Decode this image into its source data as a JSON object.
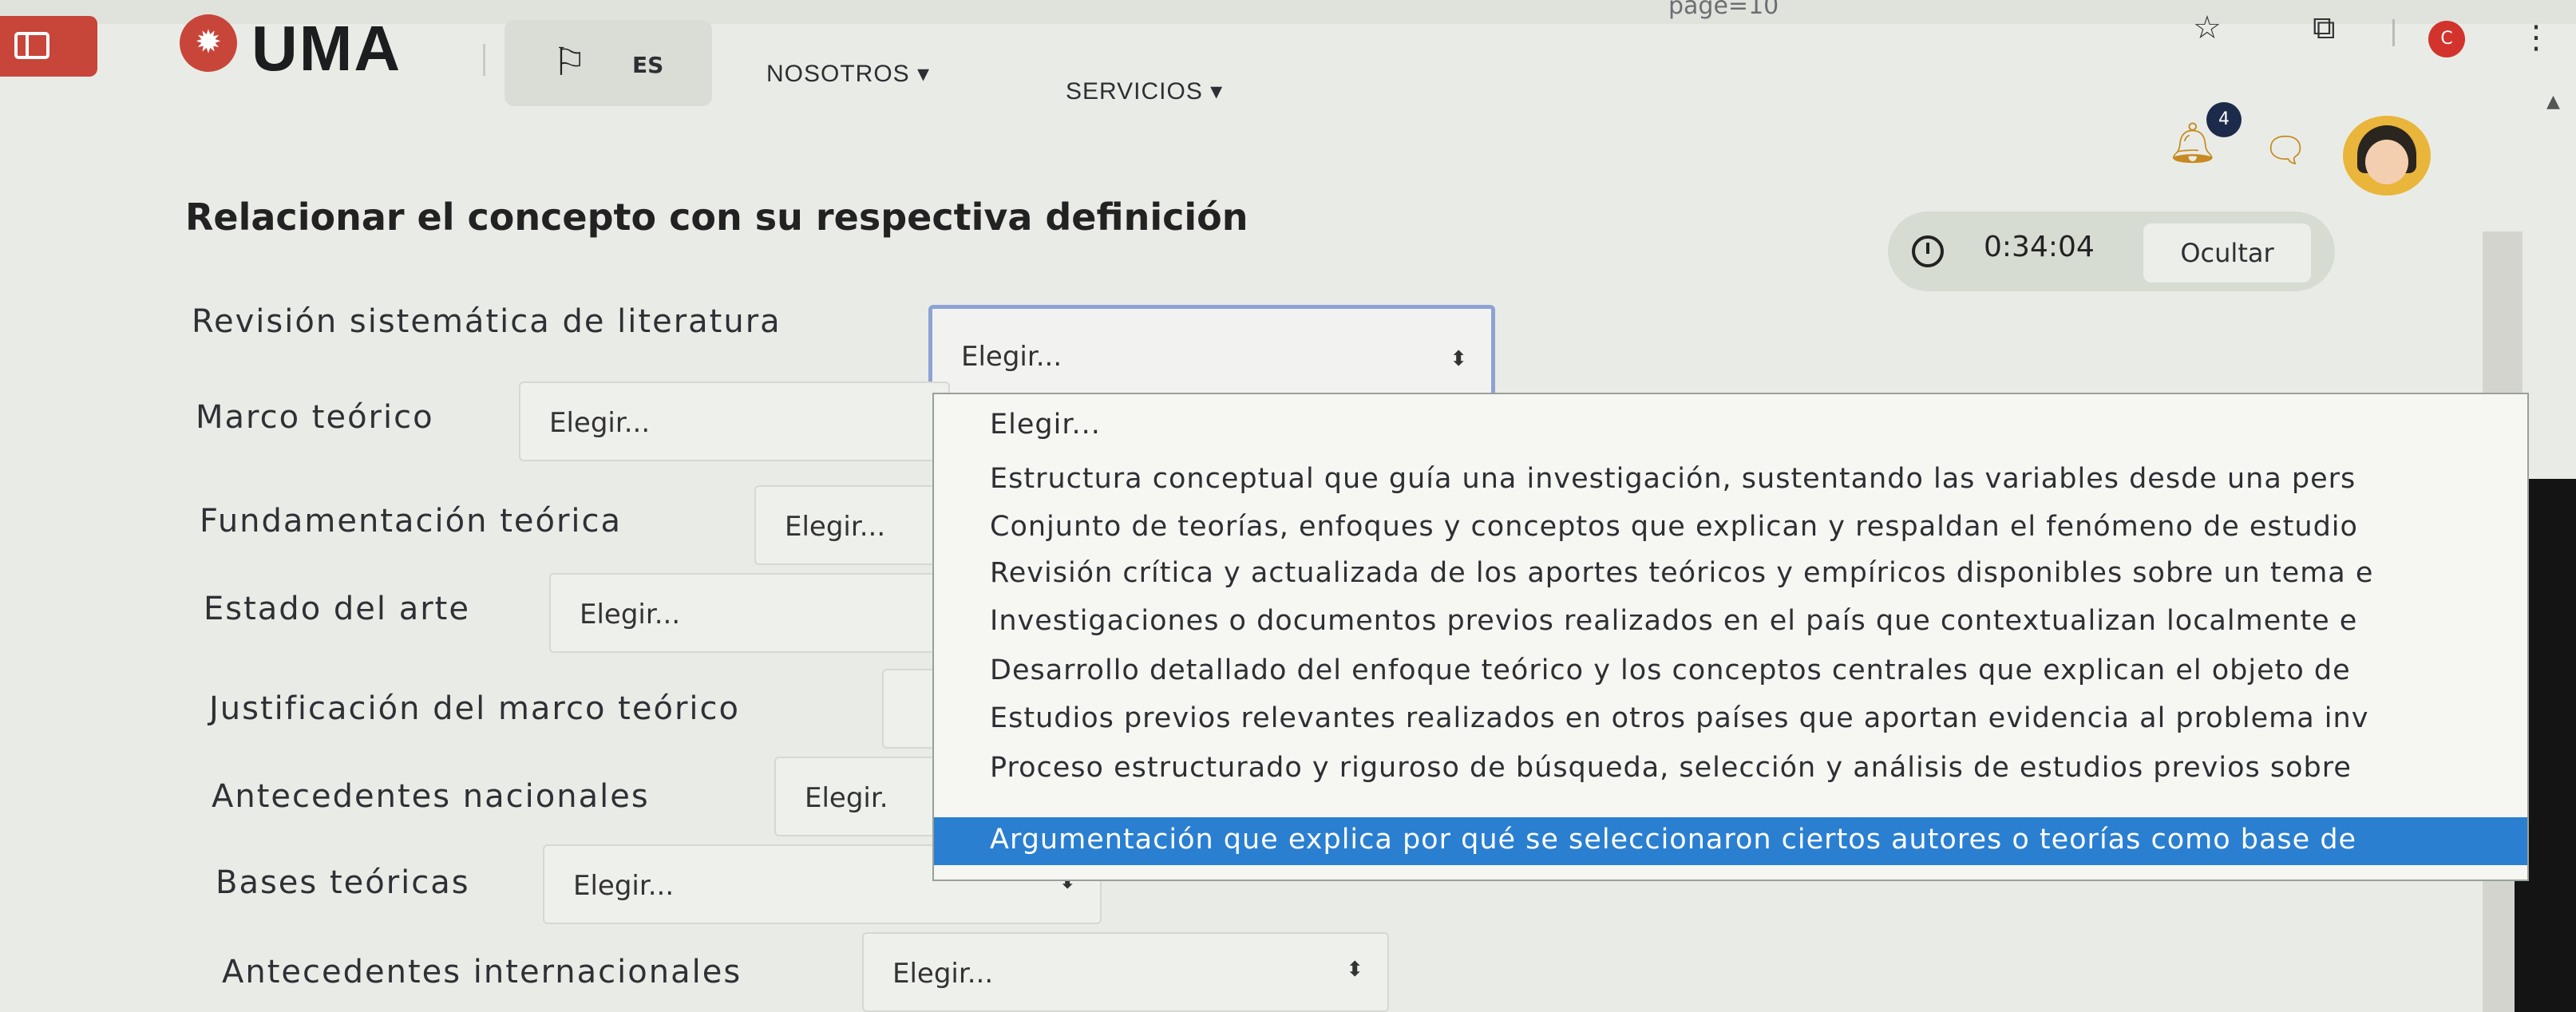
{
  "browser": {
    "url_fragment": "page=10",
    "profile_initial": "C",
    "icons": [
      "star-icon",
      "extension-icon",
      "kebab-menu-icon"
    ]
  },
  "header": {
    "logo_text": "UMA",
    "lang_label": "ES",
    "nav": {
      "nosotros": "NOSOTROS ▾",
      "servicios": "SERVICIOS ▾"
    },
    "notification_count": "4",
    "colors": {
      "brand": "#c8453a",
      "accent": "#c78a22",
      "badge": "#1c2b4b"
    }
  },
  "question": {
    "title": "Relacionar el concepto con su respectiva definición",
    "timer": "0:34:04",
    "hide_label": "Ocultar"
  },
  "rows": [
    {
      "label": "Revisión sistemática de literatura",
      "value": "Elegir..."
    },
    {
      "label": "Marco teórico",
      "value": "Elegir..."
    },
    {
      "label": "Fundamentación teórica",
      "value": "Elegir..."
    },
    {
      "label": "Estado del arte",
      "value": "Elegir..."
    },
    {
      "label": "Justificación del marco teórico",
      "value": ""
    },
    {
      "label": "Antecedentes nacionales",
      "value": "Elegir."
    },
    {
      "label": "Bases teóricas",
      "value": "Elegir..."
    },
    {
      "label": "Antecedentes internacionales",
      "value": "Elegir..."
    }
  ],
  "dropdown": {
    "selected_index": 8,
    "options": [
      "Elegir...",
      "Estructura conceptual que guía una investigación, sustentando las variables desde una pers",
      "Conjunto de teorías, enfoques y conceptos que explican y respaldan el fenómeno de estudio",
      "Revisión crítica y actualizada de los aportes teóricos y empíricos disponibles sobre un tema e",
      "Investigaciones o documentos previos realizados en el país que contextualizan localmente e",
      "Desarrollo detallado del enfoque teórico y los conceptos centrales que explican el objeto de",
      "Estudios previos relevantes realizados en otros países que aportan evidencia al problema inv",
      "Proceso estructurado y riguroso de búsqueda, selección y análisis de estudios previos sobre",
      "Argumentación que explica por qué se seleccionaron ciertos autores o teorías como base de"
    ]
  }
}
